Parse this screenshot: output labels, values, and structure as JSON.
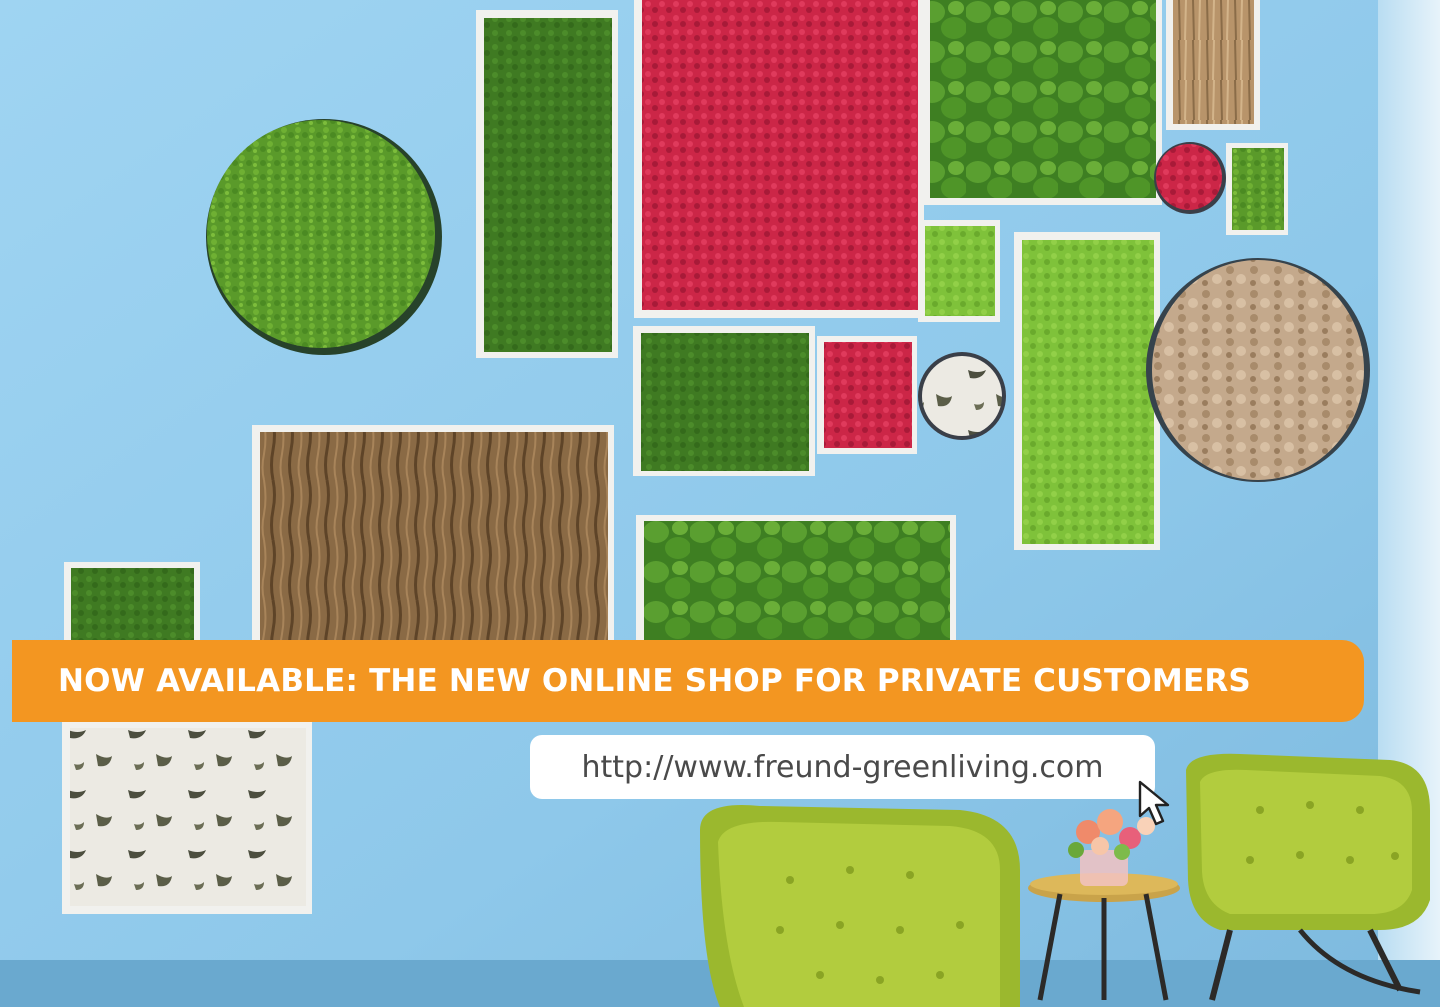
{
  "banner": {
    "headline": "NOW AVAILABLE: THE NEW ONLINE SHOP FOR PRIVATE CUSTOMERS"
  },
  "link": {
    "url": "http://www.freund-greenliving.com"
  },
  "colors": {
    "wall": "#8ec8ea",
    "banner_orange": "#f39621",
    "moss_green": "#5a9a2a",
    "moss_light": "#7fc23a",
    "moss_red": "#cc2647",
    "bark_brown": "#8a6a45",
    "chair_green": "#a6c238"
  },
  "icons": {
    "cursor": "hand-pointer-icon"
  }
}
